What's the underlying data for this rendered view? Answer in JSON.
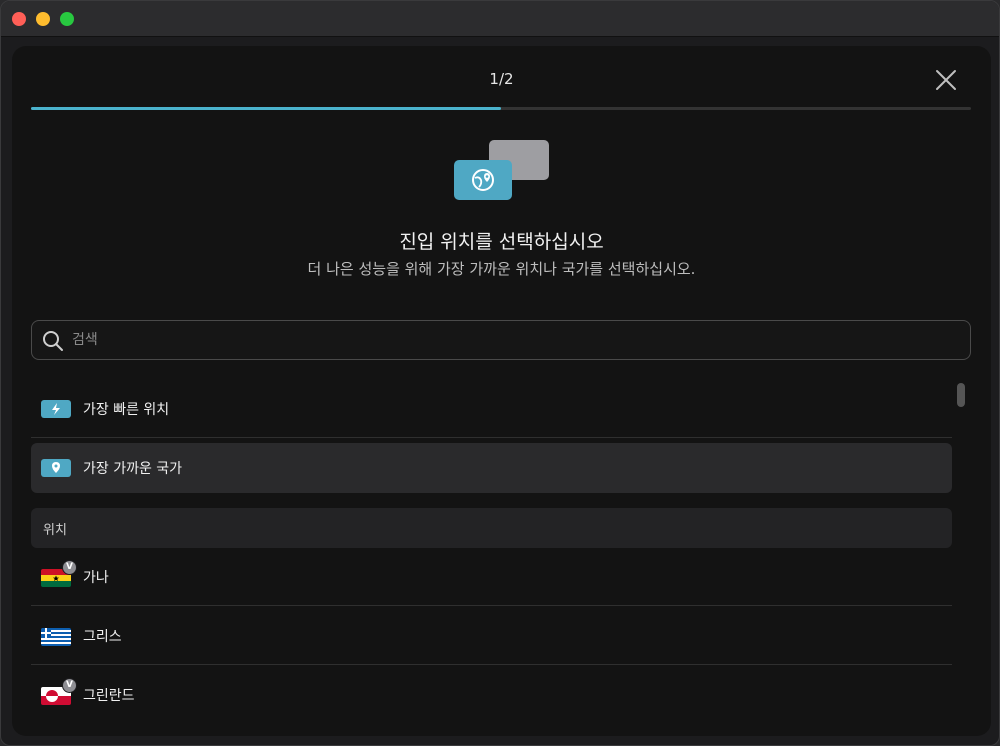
{
  "wizard": {
    "step": "1/2",
    "progress": 0.5,
    "title": "진입 위치를 선택하십시오",
    "subtitle": "더 나은 성능을 위해 가장 가까운 위치나 국가를 선택하십시오."
  },
  "search": {
    "placeholder": "검색",
    "value": ""
  },
  "options": [
    {
      "label": "가장 빠른 위치",
      "icon": "lightning-icon"
    },
    {
      "label": "가장 가까운 국가",
      "icon": "location-pin-icon",
      "selected": true
    }
  ],
  "section_header": "위치",
  "locations": [
    {
      "name": "가나",
      "flag": "ghana-flag-icon",
      "badge": "V"
    },
    {
      "name": "그리스",
      "flag": "greece-flag-icon",
      "badge": ""
    },
    {
      "name": "그린란드",
      "flag": "greenland-flag-icon",
      "badge": "V"
    }
  ],
  "colors": {
    "accent": "#4bb3cd",
    "background": "#131313"
  }
}
